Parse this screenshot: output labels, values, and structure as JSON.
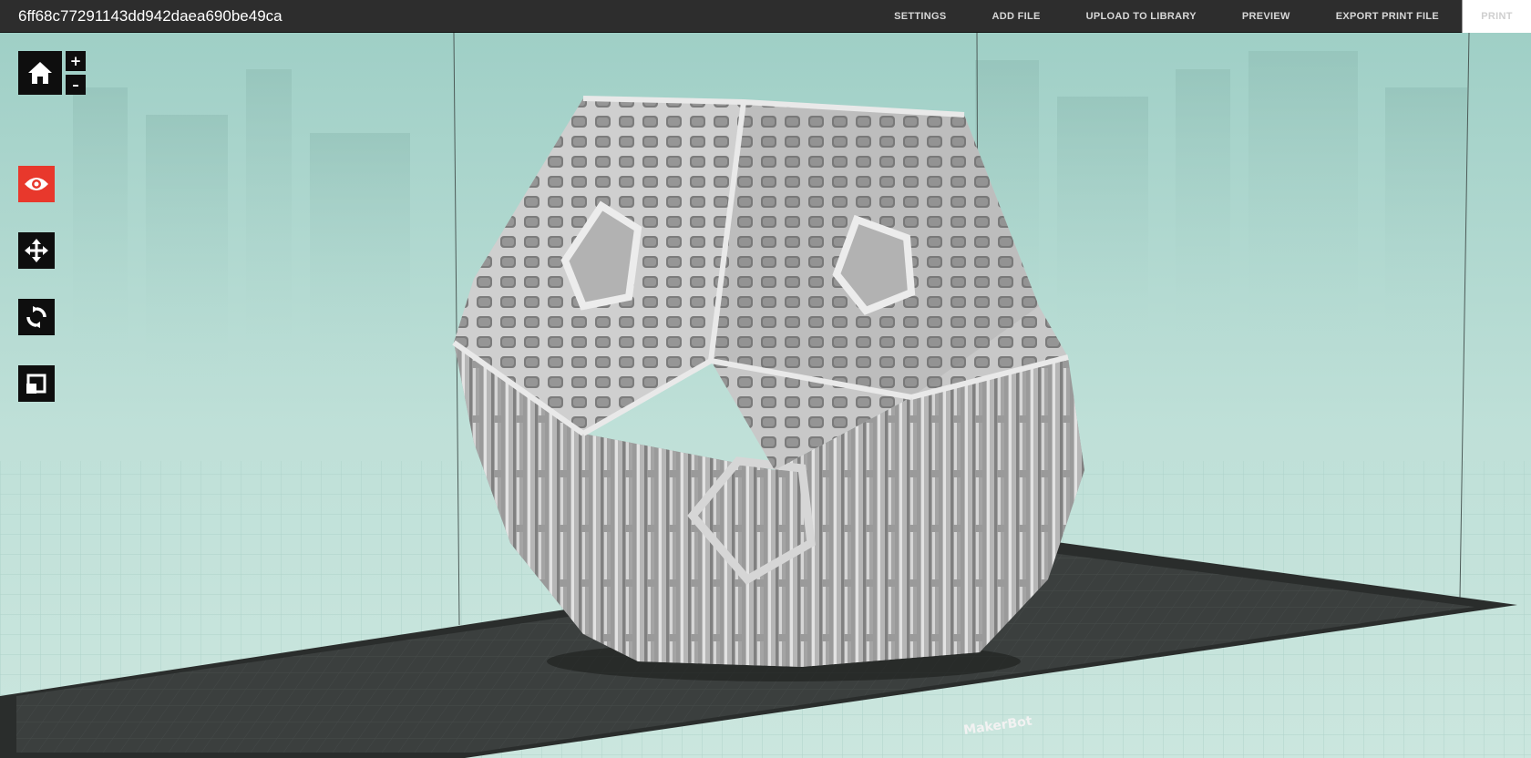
{
  "header": {
    "file_name": "6ff68c77291143dd942daea690be49ca",
    "menu": [
      {
        "label": "SETTINGS"
      },
      {
        "label": "ADD FILE"
      },
      {
        "label": "UPLOAD TO LIBRARY"
      },
      {
        "label": "PREVIEW"
      },
      {
        "label": "EXPORT PRINT FILE"
      },
      {
        "label": "PRINT",
        "state": "disabled"
      }
    ]
  },
  "toolbar": {
    "zoom_in_label": "+",
    "zoom_out_label": "–",
    "tools": [
      {
        "name": "home",
        "icon": "home-icon"
      },
      {
        "name": "view",
        "icon": "eye-icon",
        "active": true
      },
      {
        "name": "move",
        "icon": "move-arrows-icon"
      },
      {
        "name": "rotate",
        "icon": "rotate-icon"
      },
      {
        "name": "scale",
        "icon": "scale-icon"
      }
    ]
  },
  "viewport": {
    "build_plate_logo": "MakerBot"
  },
  "colors": {
    "header_bg": "#2d2d2d",
    "active_tool": "#e8382c",
    "tool_bg": "#0e0e0e",
    "scene_bg": "#b9ddd5",
    "build_plate": "#3a3e3d",
    "model": "#c9c9c9"
  }
}
